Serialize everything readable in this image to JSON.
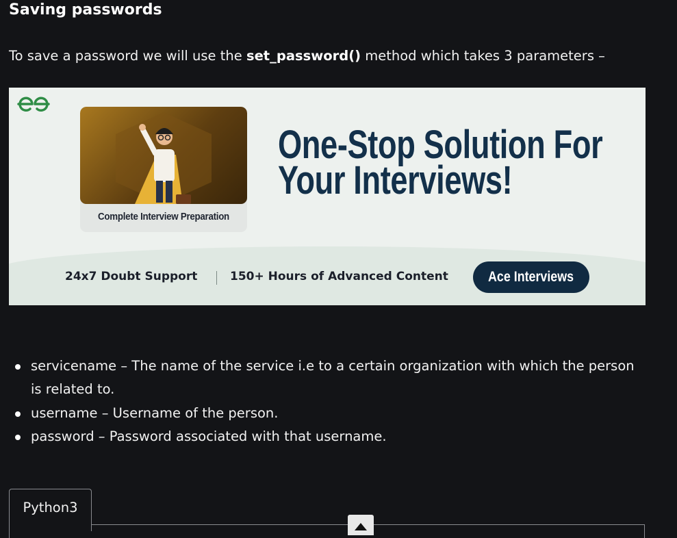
{
  "section": {
    "heading": "Saving passwords",
    "intro_before": "To save a password we will use the ",
    "intro_code": "set_password()",
    "intro_after": " method which takes 3 parameters –"
  },
  "banner": {
    "logo_icon": "gfg-logo-icon",
    "card_caption": "Complete Interview Preparation",
    "headline_line1": "One-Stop Solution For",
    "headline_line2": "Your Interviews!",
    "feature_1": "24x7 Doubt Support",
    "feature_2": "150+ Hours of Advanced Content",
    "cta_label": "Ace Interviews",
    "colors": {
      "background": "#edf1ee",
      "headline": "#13304a",
      "cta_bg": "#102a41",
      "logo_green": "#2f8d46"
    }
  },
  "params": [
    {
      "text": "servicename – The name of the service i.e to a certain organization with which the person is related to."
    },
    {
      "text": "username – Username of the person."
    },
    {
      "text": "password – Password associated with that username."
    }
  ],
  "code_block": {
    "tab_label": "Python3",
    "scroll_icon": "scroll-top-icon"
  }
}
